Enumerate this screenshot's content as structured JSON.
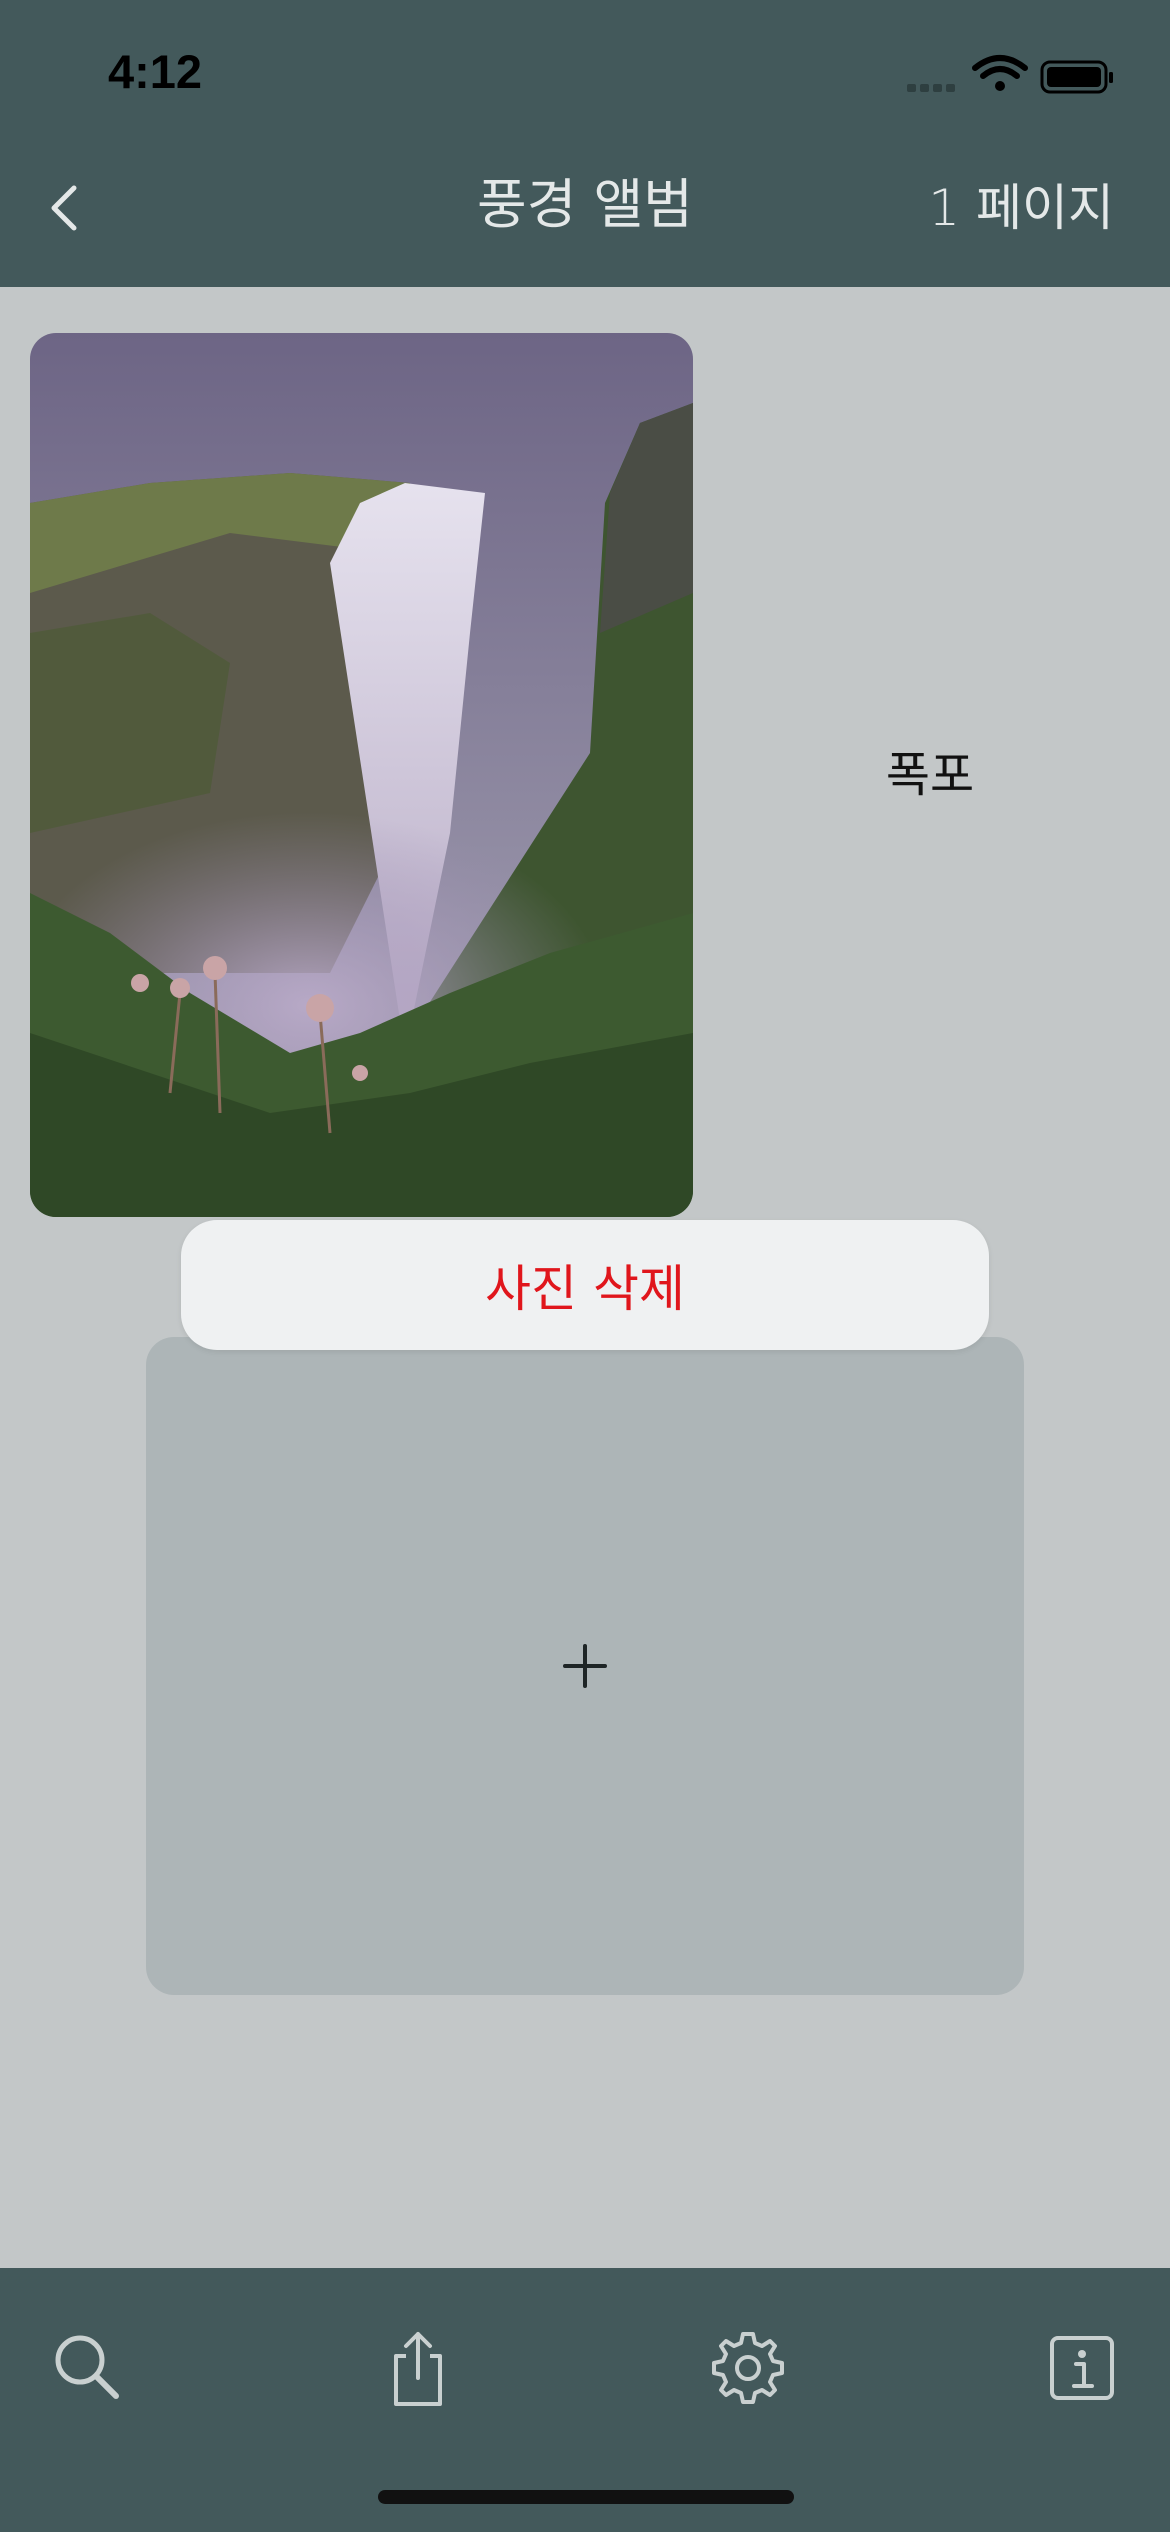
{
  "status_bar": {
    "time": "4:12",
    "icons": [
      "cellular-signal-icon",
      "wifi-icon",
      "battery-icon"
    ]
  },
  "nav": {
    "back_icon": "chevron-left-icon",
    "title": "풍경 앨범",
    "page_indicator": "1 페이지"
  },
  "photo": {
    "caption": "폭포",
    "image_description_icon": "waterfall-photo"
  },
  "context_menu": {
    "delete_label": "사진 삭제",
    "delete_color": "#e0161c"
  },
  "add_slot": {
    "icon": "plus-icon"
  },
  "toolbar": {
    "items": [
      {
        "icon": "search-icon"
      },
      {
        "icon": "share-icon"
      },
      {
        "icon": "settings-gear-icon"
      },
      {
        "icon": "info-icon"
      }
    ]
  },
  "colors": {
    "header_background": "#43595b",
    "page_background": "#c3c7c8",
    "slot_background": "#adb5b7",
    "menu_background": "#eff1f2"
  }
}
